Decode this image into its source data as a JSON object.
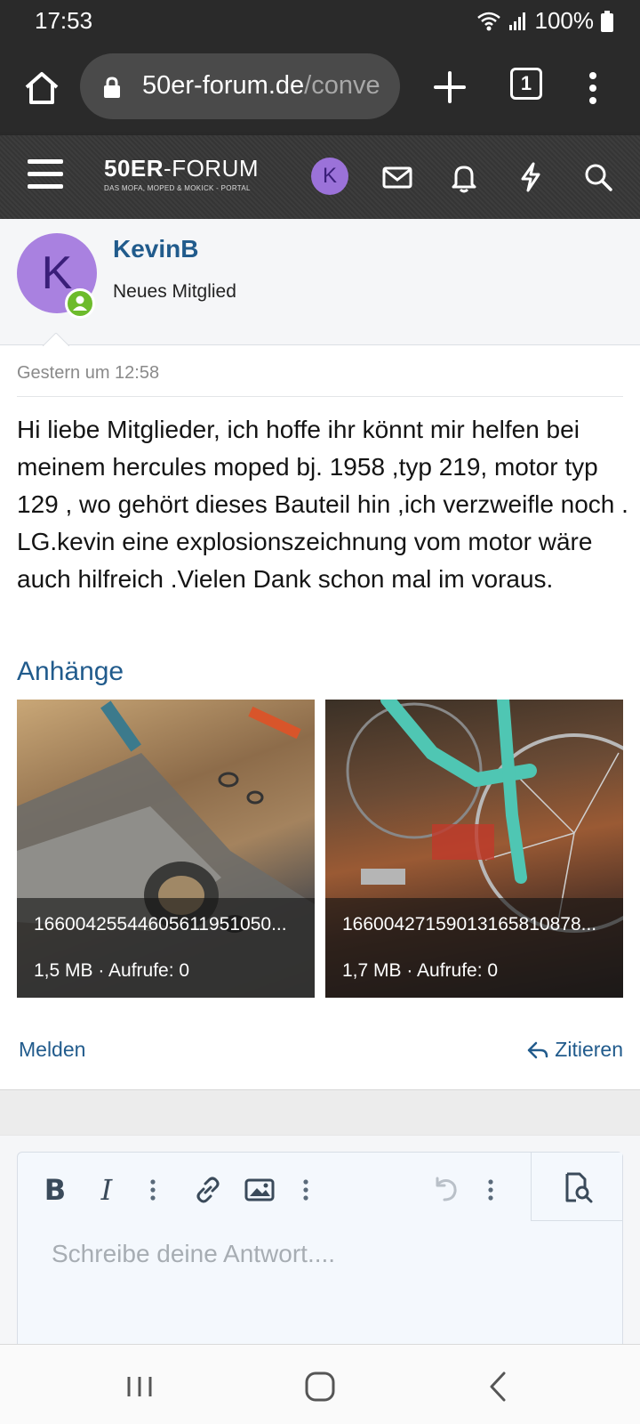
{
  "status_bar": {
    "time": "17:53",
    "battery": "100%",
    "icons": [
      "wifi-icon",
      "signal-icon",
      "battery-icon"
    ]
  },
  "browser": {
    "url_host": "50er-forum.de",
    "url_path": "/conve",
    "tab_count": "1",
    "icons": [
      "home-icon",
      "lock-icon",
      "plus-icon",
      "menu-dots-icon"
    ]
  },
  "forum_header": {
    "logo_title_bold": "50ER",
    "logo_title_rest": "-FORUM",
    "logo_subtitle": "DAS MOFA, MOPED & MOKICK - PORTAL",
    "avatar_letter": "K",
    "icons": [
      "hamburger-icon",
      "mail-icon",
      "bell-icon",
      "bolt-icon",
      "search-icon"
    ]
  },
  "author": {
    "avatar_letter": "K",
    "username": "KevinB",
    "user_title": "Neues Mitglied"
  },
  "post": {
    "date": "Gestern um 12:58",
    "body": "Hi liebe Mitglieder, ich hoffe ihr könnt mir helfen bei meinem hercules moped bj. 1958 ,typ 219, motor typ 129 , wo gehört dieses Bauteil hin ,ich verzweifle noch . LG.kevin eine explosionszeichnung vom motor wäre auch hilfreich .Vielen Dank schon mal im voraus.",
    "attachments_title": "Anhänge",
    "attachments": [
      {
        "filename": "16600425544605611951050...",
        "meta": "1,5 MB · Aufrufe: 0"
      },
      {
        "filename": "16600427159013165810878...",
        "meta": "1,7 MB · Aufrufe: 0"
      }
    ],
    "report_label": "Melden",
    "quote_label": "Zitieren"
  },
  "editor": {
    "bold_label": "B",
    "italic_label": "I",
    "placeholder": "Schreibe deine Antwort....",
    "icons": [
      "bold-icon",
      "italic-icon",
      "more-icon",
      "link-icon",
      "image-icon",
      "undo-icon",
      "preview-icon"
    ]
  },
  "colors": {
    "link_blue": "#215b8c",
    "avatar_purple": "#a981e0",
    "online_green": "#6dbb2c",
    "browser_dark": "#2a2a2a"
  }
}
